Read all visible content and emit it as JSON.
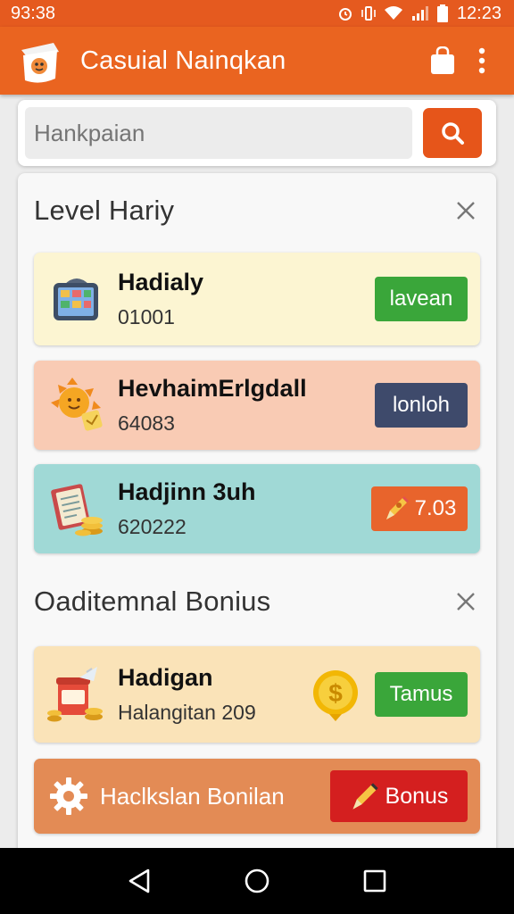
{
  "status_bar": {
    "time_left": "93:38",
    "time_right": "12:23"
  },
  "app_bar": {
    "title": "Casuial Nainqkan"
  },
  "search": {
    "placeholder": "Hankpaian"
  },
  "sections": [
    {
      "title": "Level Hariy",
      "items": [
        {
          "name": "Hadialy",
          "sub": "01001",
          "button": "lavean",
          "icon": "tablet-icon",
          "bg": "#fcf5d2",
          "button_color": "#3aa63a"
        },
        {
          "name": "HevhaimErlgdall",
          "sub": "64083",
          "button": "lonloh",
          "icon": "sun-icon",
          "bg": "#f9cbb4",
          "button_color": "#3e4a6b"
        },
        {
          "name": "Hadjinn 3uh",
          "sub": "620222",
          "button": "7.03",
          "icon": "document-coins-icon",
          "bg": "#a0d9d6",
          "button_color": "#e8642c"
        }
      ]
    },
    {
      "title": "Oaditemnal Bonius",
      "items": [
        {
          "name": "Hadigan",
          "sub": "Halangitan 209",
          "button": "Tamus",
          "icon": "jar-coins-icon",
          "badge_icon": "dollar-coin-icon",
          "bg": "#fae3b8",
          "button_color": "#3aa63a"
        }
      ]
    }
  ],
  "bonus_bar": {
    "label": "Haclkslan Bonilan",
    "button": "Bonus",
    "bg": "#e38b55",
    "button_color": "#d41f1f"
  },
  "colors": {
    "accent": "#ea6420",
    "status_bar": "#e55a1f",
    "search_button": "#e6551a"
  }
}
